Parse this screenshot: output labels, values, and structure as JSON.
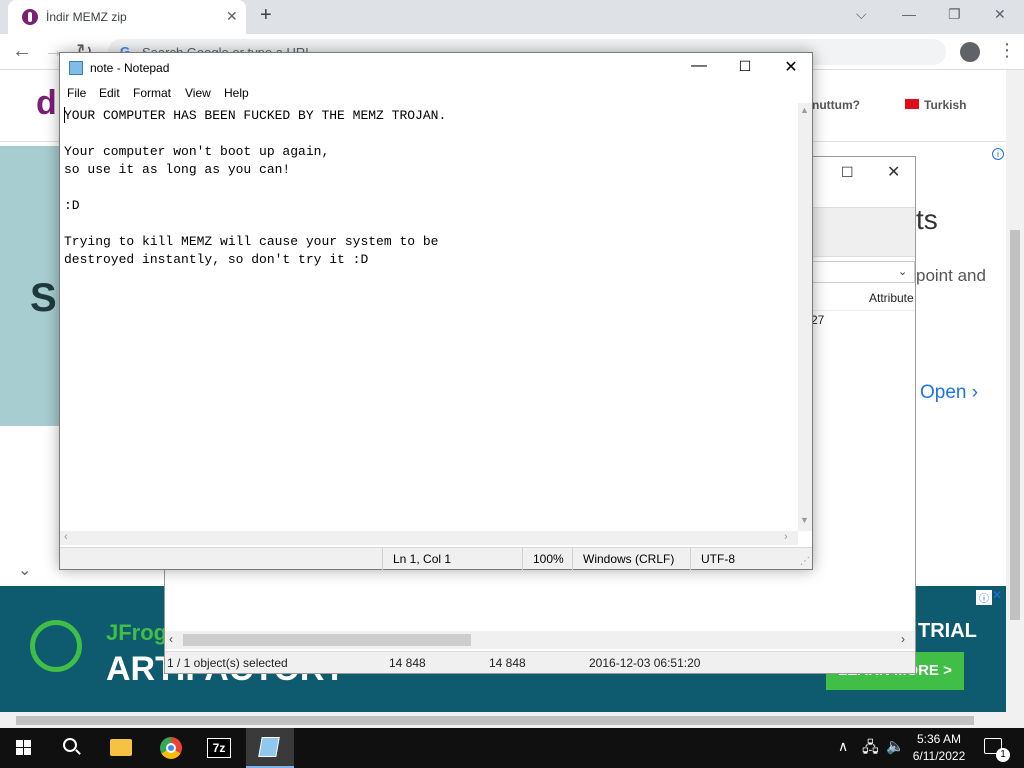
{
  "browser": {
    "tab_title": "İndir MEMZ zip",
    "tab_close": "✕",
    "new_tab": "+",
    "minimize": "⌵",
    "restore": "—",
    "maximize": "❐",
    "close": "✕",
    "back": "←",
    "forward": "→",
    "reload": "↻",
    "omnibox_g": "G",
    "omnibox_placeholder": "Search Google or type a URL",
    "menu": "⋮"
  },
  "site": {
    "logo": "d",
    "forgot_link": "nuttum?",
    "language": "Turkish",
    "bg_heading_fragment": "ts",
    "bg_text_fragment": "point and",
    "open_label": "Open ›",
    "ad_left_big": "S",
    "ad_info": "i",
    "chevron": "⌄"
  },
  "ad_bottom": {
    "jfrog": "JFrog",
    "artifactory": "ARTIFACTORY",
    "trial": "TRIAL",
    "learn_more": "LEARN MORE >",
    "info": "ⓘ",
    "close": "✕"
  },
  "zip": {
    "maximize": "☐",
    "close": "✕",
    "path_arrow": "⌄",
    "col_attributes": "Attribute",
    "cell_fragment": "27",
    "scroll_left": "‹",
    "scroll_right": "›",
    "status": {
      "selected": "1 / 1 object(s) selected",
      "size": "14 848",
      "packed": "14 848",
      "modified": "2016-12-03 06:51:20"
    }
  },
  "notepad": {
    "title": "note - Notepad",
    "minimize": "—",
    "maximize": "☐",
    "close": "✕",
    "menu": {
      "file": "File",
      "edit": "Edit",
      "format": "Format",
      "view": "View",
      "help": "Help"
    },
    "content": "YOUR COMPUTER HAS BEEN FUCKED BY THE MEMZ TROJAN.\n\nYour computer won't boot up again,\nso use it as long as you can!\n\n:D\n\nTrying to kill MEMZ will cause your system to be\ndestroyed instantly, so don't try it :D",
    "scroll_up": "▲",
    "scroll_down": "▼",
    "scroll_left": "‹",
    "scroll_right": "›",
    "status": {
      "position": "Ln 1, Col 1",
      "zoom": "100%",
      "line_ending": "Windows (CRLF)",
      "encoding": "UTF-8"
    },
    "grip": "⋰"
  },
  "taskbar": {
    "seven_zip_label": "7z",
    "tray_chevron": "∧",
    "network": "🖧",
    "volume": "🔈",
    "time": "5:36 AM",
    "date": "6/11/2022",
    "notification_count": "1"
  }
}
